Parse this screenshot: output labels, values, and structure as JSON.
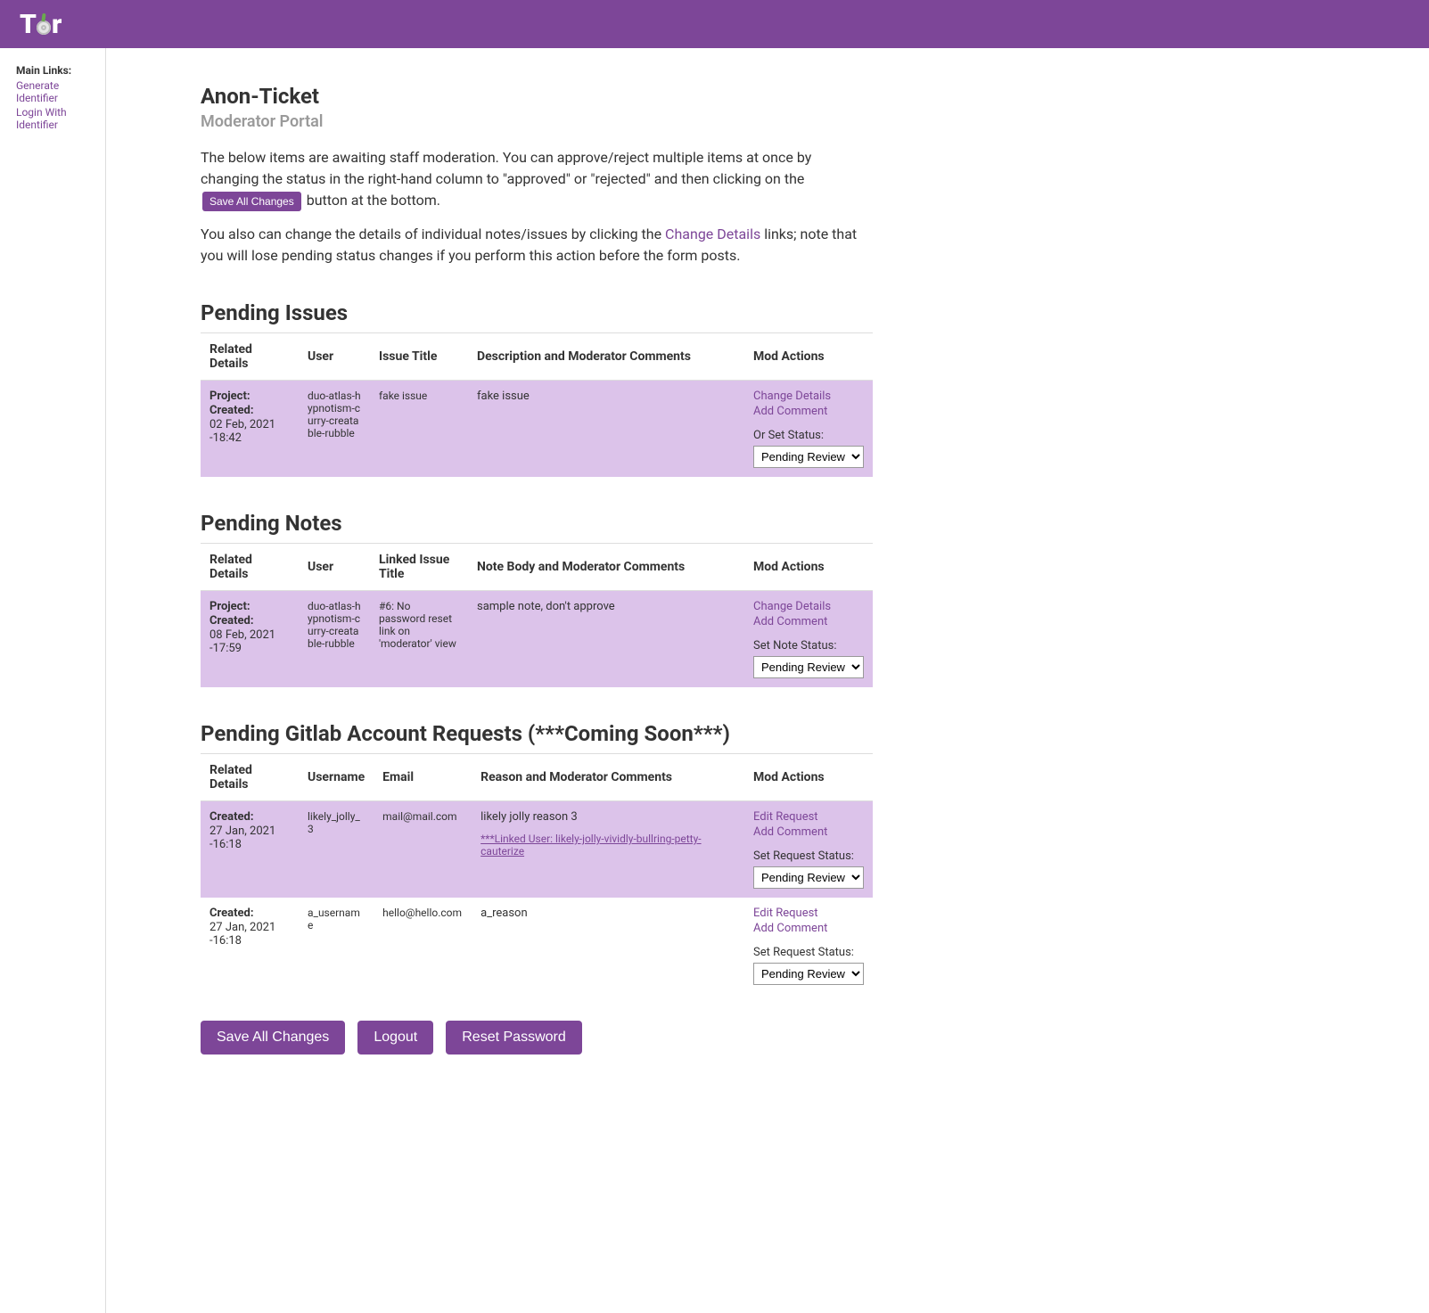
{
  "logo": {
    "t1": "T",
    "t2": "r"
  },
  "sidebar": {
    "heading": "Main Links:",
    "links": [
      {
        "label": "Generate Identifier"
      },
      {
        "label": "Login With Identifier"
      }
    ]
  },
  "header": {
    "title": "Anon-Ticket",
    "subtitle": "Moderator Portal"
  },
  "intro": {
    "p1a": "The below items are awaiting staff moderation. You can approve/reject multiple items at once by changing the status in the right-hand column to \"approved\" or \"rejected\" and then clicking on the",
    "save_btn": "Save All Changes",
    "p1b": "button at the bottom.",
    "p2a": "You also can change the details of individual notes/issues by clicking the",
    "change_link": "Change Details",
    "p2b": "links; note that you will lose pending status changes if you perform this action before the form posts."
  },
  "status_options": [
    "Pending Review"
  ],
  "issues": {
    "title": "Pending Issues",
    "headers": [
      "Related Details",
      "User",
      "Issue Title",
      "Description and Moderator Comments",
      "Mod Actions"
    ],
    "rows": [
      {
        "project_label": "Project:",
        "created_label": "Created:",
        "created": "02 Feb, 2021 -18:42",
        "user": "duo-atlas-hypnotism-curry-creatable-rubble",
        "title": "fake issue",
        "desc": "fake issue",
        "change": "Change Details",
        "comment": "Add Comment",
        "status_label": "Or Set Status:",
        "status": "Pending Review"
      }
    ]
  },
  "notes": {
    "title": "Pending Notes",
    "headers": [
      "Related Details",
      "User",
      "Linked Issue Title",
      "Note Body and Moderator Comments",
      "Mod Actions"
    ],
    "rows": [
      {
        "project_label": "Project:",
        "created_label": "Created:",
        "created": "08 Feb, 2021 -17:59",
        "user": "duo-atlas-hypnotism-curry-creatable-rubble",
        "title": "#6: No password reset link on 'moderator' view",
        "desc": "sample note, don't approve",
        "change": "Change Details",
        "comment": "Add Comment",
        "status_label": "Set Note Status:",
        "status": "Pending Review"
      }
    ]
  },
  "requests": {
    "title": "Pending Gitlab Account Requests (***Coming Soon***)",
    "headers": [
      "Related Details",
      "Username",
      "Email",
      "Reason and Moderator Comments",
      "Mod Actions"
    ],
    "rows": [
      {
        "created_label": "Created:",
        "created": "27 Jan, 2021 -16:18",
        "user": "likely_jolly_3",
        "email": "mail@mail.com",
        "reason": "likely jolly reason 3",
        "linked_user": "***Linked User: likely-jolly-vividly-bullring-petty-cauterize",
        "change": "Edit Request",
        "comment": "Add Comment",
        "status_label": "Set Request Status:",
        "status": "Pending Review"
      },
      {
        "created_label": "Created:",
        "created": "27 Jan, 2021 -16:18",
        "user": "a_username",
        "email": "hello@hello.com",
        "reason": "a_reason",
        "linked_user": "",
        "change": "Edit Request",
        "comment": "Add Comment",
        "status_label": "Set Request Status:",
        "status": "Pending Review"
      }
    ]
  },
  "buttons": {
    "save": "Save All Changes",
    "logout": "Logout",
    "reset": "Reset Password"
  }
}
